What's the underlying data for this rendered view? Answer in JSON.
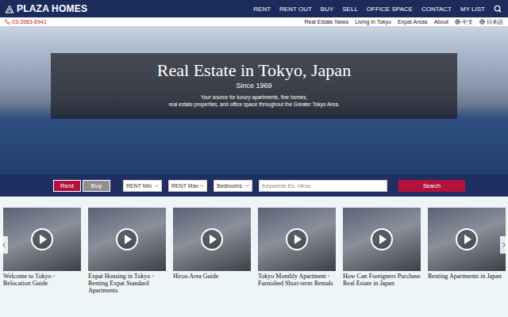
{
  "header": {
    "logo": "PLAZA HOMES",
    "nav": [
      "RENT",
      "RENT OUT",
      "BUY",
      "SELL",
      "OFFICE SPACE",
      "CONTACT",
      "MY LIST"
    ]
  },
  "topbar": {
    "phone": "03-3583-6941",
    "links": [
      "Real Estate News",
      "Living in Tokyo",
      "Expat Areas",
      "About"
    ],
    "languages": [
      "中文",
      "日本語"
    ]
  },
  "hero": {
    "title": "Real Estate in Tokyo, Japan",
    "since": "Since 1969",
    "tagline": [
      "Your source for luxury apartments, fine homes,",
      "real estate properties, and office space throughout the Greater Tokyo Area."
    ]
  },
  "search": {
    "modes": [
      {
        "label": "Rent",
        "selected": true
      },
      {
        "label": "Buy",
        "selected": false
      }
    ],
    "selects": [
      "RENT Min",
      "RENT Max",
      "Bedrooms"
    ],
    "keyword_placeholder": "Keywords Ex. Hiroo",
    "button": "Search"
  },
  "videos": [
    {
      "title": "Welcome to Tokyo - Relocation Guide"
    },
    {
      "title": "Expat Housing in Tokyo - Renting Expat Standard Apartments"
    },
    {
      "title": "Hiroo Area Guide"
    },
    {
      "title": "Tokyo Monthly Apartment - Furnished Short-term Rentals"
    },
    {
      "title": "How Can Foreigners Purchase Real Estate in Japan"
    },
    {
      "title": "Renting Apartments in Japan"
    }
  ]
}
